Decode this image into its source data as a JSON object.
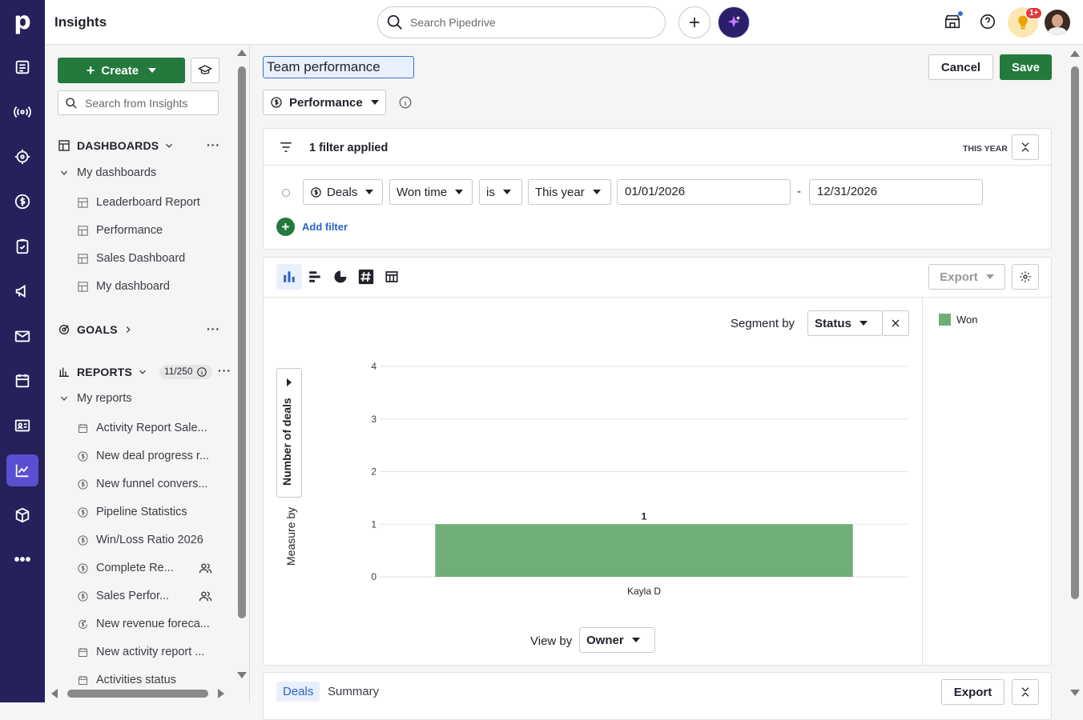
{
  "app": {
    "title": "Insights",
    "search_placeholder": "Search Pipedrive",
    "notif_badge": "1+"
  },
  "sidebar": {
    "create_label": "Create",
    "search_placeholder": "Search from Insights",
    "dashboards_label": "DASHBOARDS",
    "my_dashboards_label": "My dashboards",
    "dashboards": [
      "Leaderboard Report",
      "Performance",
      "Sales Dashboard",
      "My dashboard"
    ],
    "goals_label": "GOALS",
    "reports_label": "REPORTS",
    "reports_count": "11/250",
    "my_reports_label": "My reports",
    "reports": [
      {
        "label": "Activity Report Sale...",
        "icon": "calendar-icon",
        "shared": false
      },
      {
        "label": "New deal progress r...",
        "icon": "dollar-icon",
        "shared": false
      },
      {
        "label": "New funnel convers...",
        "icon": "dollar-icon",
        "shared": false
      },
      {
        "label": "Pipeline Statistics",
        "icon": "dollar-icon",
        "shared": false
      },
      {
        "label": "Win/Loss Ratio 2026",
        "icon": "dollar-icon",
        "shared": false
      },
      {
        "label": "Complete Re...",
        "icon": "dollar-icon",
        "shared": true
      },
      {
        "label": "Sales Perfor...",
        "icon": "dollar-icon",
        "shared": true
      },
      {
        "label": "New revenue foreca...",
        "icon": "revenue-icon",
        "shared": false
      },
      {
        "label": "New activity report ...",
        "icon": "calendar-icon",
        "shared": false
      },
      {
        "label": "Activities status",
        "icon": "calendar-icon",
        "shared": false
      }
    ]
  },
  "editor": {
    "report_title": "Team performance",
    "cancel_label": "Cancel",
    "save_label": "Save",
    "report_type": "Performance"
  },
  "filters": {
    "summary": "1 filter applied",
    "period_tag": "THIS YEAR",
    "entity": "Deals",
    "field": "Won time",
    "operator": "is",
    "period": "This year",
    "date_from": "01/01/2026",
    "separator": "-",
    "date_to": "12/31/2026",
    "add_filter_label": "Add filter"
  },
  "chart_toolbar": {
    "export_label": "Export"
  },
  "chart_controls": {
    "segment_by_label": "Segment by",
    "segment_by_value": "Status",
    "measure_by_label": "Measure by",
    "measure_value": "Number of deals",
    "view_by_label": "View by",
    "view_by_value": "Owner"
  },
  "chart_data": {
    "type": "bar",
    "categories": [
      "Kayla D"
    ],
    "series": [
      {
        "name": "Won",
        "values": [
          1
        ],
        "color": "#6fae78"
      }
    ],
    "ylim": [
      0,
      4
    ],
    "yticks": [
      0,
      1,
      2,
      3,
      4
    ],
    "data_labels": [
      "1"
    ],
    "legend_position": "right"
  },
  "bottom_tabs": {
    "deals_label": "Deals",
    "summary_label": "Summary",
    "export_label": "Export"
  }
}
